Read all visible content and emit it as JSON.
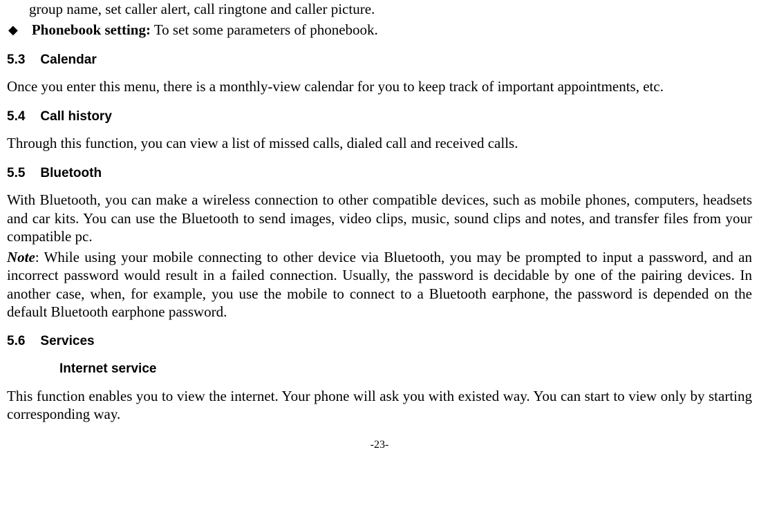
{
  "top_fragment": "group name, set caller alert, call ringtone and caller picture.",
  "bullet": {
    "label": "Phonebook setting:",
    "text": " To set some parameters of phonebook."
  },
  "sections": {
    "calendar": {
      "num": "5.3",
      "title": "Calendar",
      "body": "Once you enter this menu, there is a monthly-view calendar for you to keep track of important appointments, etc."
    },
    "callhistory": {
      "num": "5.4",
      "title": "Call history",
      "body": "Through this function, you can view a list of missed calls, dialed call and received calls."
    },
    "bluetooth": {
      "num": "5.5",
      "title": "Bluetooth",
      "body1": "With Bluetooth, you can make a wireless connection to other compatible devices, such as mobile phones, computers, headsets and car kits. You can use the Bluetooth to send images, video clips, music, sound clips and notes, and transfer files from your compatible pc.",
      "note_label": "Note",
      "note_body": ": While using your mobile connecting to other device via Bluetooth, you may be prompted to input a password, and an incorrect password would result in a failed connection. Usually, the password is decidable by one of the pairing devices. In another case, when, for example, you use the mobile to connect to a Bluetooth earphone, the password is depended on the default Bluetooth earphone password."
    },
    "services": {
      "num": "5.6",
      "title": "Services",
      "subtitle": "Internet service",
      "body": "This function enables you to view the internet. Your phone will ask you with existed way. You can start to view only by starting corresponding way."
    }
  },
  "page_number": "-23-"
}
